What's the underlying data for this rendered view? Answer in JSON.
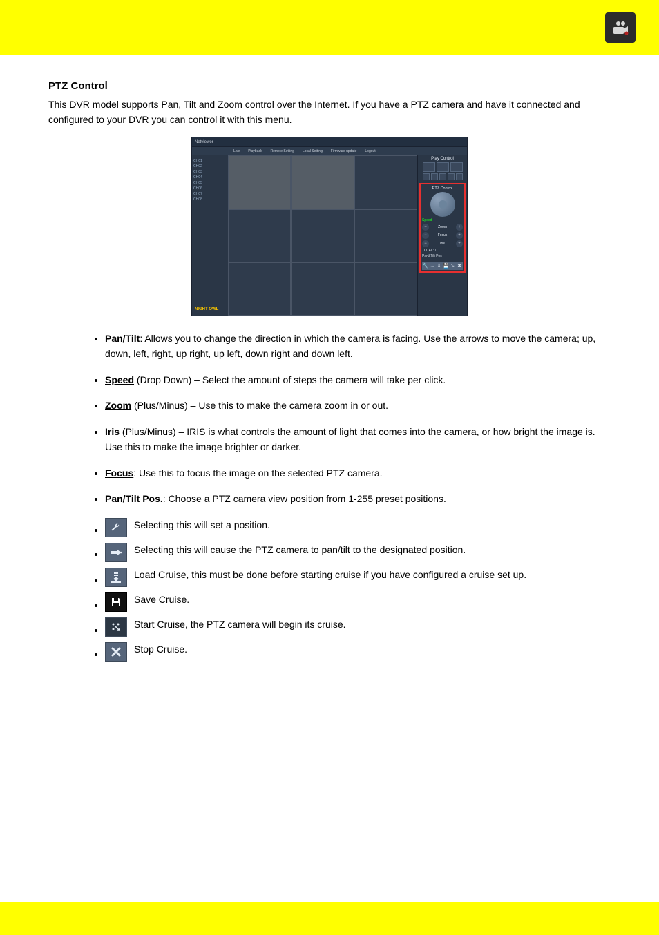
{
  "topbar": {
    "icon_name": "video-camera-icon"
  },
  "section": {
    "heading": "PTZ Control",
    "para": "This DVR model supports Pan, Tilt and Zoom control over the Internet. If you have a PTZ camera and have it connected and configured to your DVR you can control it with this menu."
  },
  "screenshot": {
    "title": "Netviewer",
    "menus": [
      "Live",
      "Playback",
      "Remote Setting",
      "Local Setting",
      "Firmware update",
      "Logout"
    ],
    "channels": [
      "CH01",
      "CH02",
      "CH03",
      "CH04",
      "CH05",
      "CH06",
      "CH07",
      "CH08"
    ],
    "logo": "NIGHT OWL",
    "play_control": "Play Control",
    "ptz_control": "PTZ Control",
    "speed_label": "Speed",
    "rows": [
      "Zoom",
      "Focus",
      "Iris"
    ],
    "total": "TOTAL:0",
    "pan_tilt": "Pan&Tilt Pos"
  },
  "bullets": [
    {
      "term": "Pan/Tilt",
      "rest": ": Allows you to change the direction in which the camera is facing. Use the arrows to move the camera; up, down, left, right, up right, up left, down right and down left."
    },
    {
      "term": "Speed",
      "rest": " (Drop Down) – Select the amount of steps the camera will take per click."
    },
    {
      "term": "Zoom",
      "rest": " (Plus/Minus) – Use this to make the camera zoom in or out."
    },
    {
      "term": "Iris",
      "rest": " (Plus/Minus) – IRIS is what controls the amount of light that comes into the camera, or how bright the image is. Use this to make the image brighter or darker."
    },
    {
      "term": "Focus",
      "rest": ": Use this to focus the image on the selected PTZ camera."
    },
    {
      "term": "Pan/Tilt Pos.",
      "rest": ": Choose a PTZ camera view position from 1-255 preset positions."
    }
  ],
  "icons": [
    {
      "name": "wrench-icon",
      "text": "Selecting this will set a position."
    },
    {
      "name": "goto-icon",
      "text": "Selecting this will cause the PTZ camera to pan/tilt to the designated position."
    },
    {
      "name": "load-icon",
      "text": "Load Cruise, this must be done before starting cruise if you have configured a cruise set up."
    },
    {
      "name": "save-icon",
      "text": "Save Cruise."
    },
    {
      "name": "start-cruise-icon",
      "text": "Start Cruise, the PTZ camera will begin its cruise."
    },
    {
      "name": "stop-cruise-icon",
      "text": "Stop Cruise."
    }
  ]
}
